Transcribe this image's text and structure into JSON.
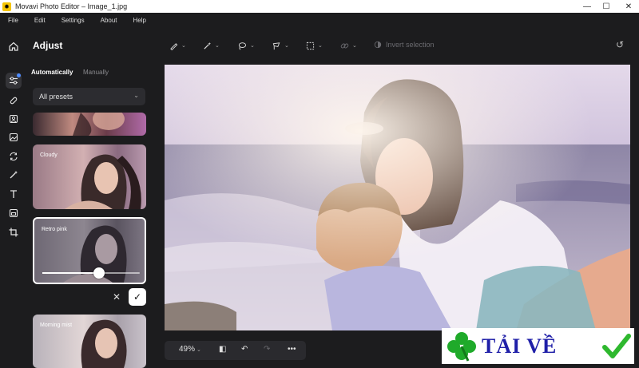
{
  "window": {
    "title": "Movavi Photo Editor – Image_1.jpg",
    "controls": [
      "minimize",
      "maximize",
      "close"
    ]
  },
  "menu": [
    "File",
    "Edit",
    "Settings",
    "About",
    "Help"
  ],
  "rail": {
    "icons": [
      "home-icon",
      "adjust-icon",
      "retouch-icon",
      "portrait-icon",
      "background-icon",
      "replace-icon",
      "effects-icon",
      "text-icon",
      "crop-frame-icon",
      "crop-icon"
    ]
  },
  "panel": {
    "title": "Adjust",
    "tabs": {
      "auto": "Automatically",
      "manual": "Manually"
    },
    "preset_select": "All presets",
    "presets": [
      {
        "label": ""
      },
      {
        "label": "Cloudy"
      },
      {
        "label": "Retro pink",
        "selected": true,
        "intensity": 0.58
      },
      {
        "label": "Morning mist"
      }
    ]
  },
  "toolbar": {
    "tools": [
      "brush-icon",
      "magic-wand-icon",
      "lasso-icon",
      "polygon-lasso-icon",
      "rect-select-icon",
      "link-icon"
    ],
    "invert_selection": "Invert selection"
  },
  "bottom": {
    "zoom": "49%"
  },
  "watermark": {
    "text": "TẢI VỀ"
  },
  "colors": {
    "accent": "#4f8cff",
    "watermark_text": "#1f1fa8",
    "check_green": "#2eb82e"
  }
}
